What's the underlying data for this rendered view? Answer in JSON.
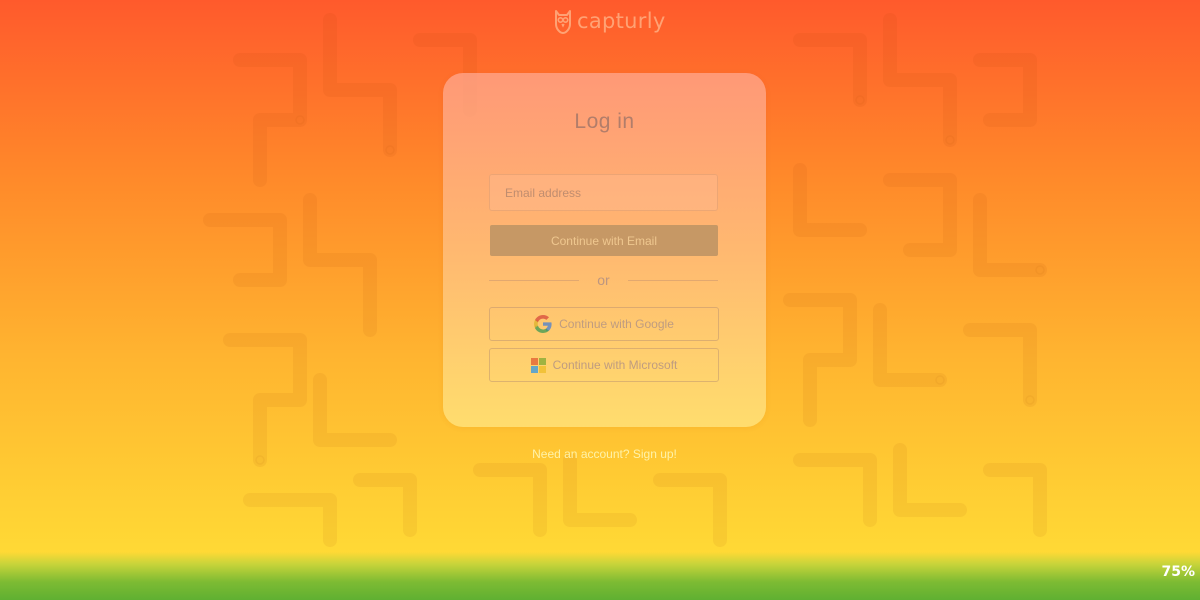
{
  "brand": {
    "name": "capturly",
    "logo_icon": "owl-icon"
  },
  "login_card": {
    "title": "Log in",
    "email_placeholder": "Email address",
    "email_value": "",
    "continue_email_label": "Continue with Email",
    "divider_text": "or",
    "google_label": "Continue with Google",
    "google_icon": "google-icon",
    "microsoft_label": "Continue with Microsoft",
    "microsoft_icon": "microsoft-icon"
  },
  "signup": {
    "text": "Need an account? Sign up!"
  },
  "overlay": {
    "zoom_percent": "75%"
  },
  "colors": {
    "gradient_top": "#ff5a2c",
    "gradient_middle": "#ffb530",
    "gradient_bottom": "#ffd935",
    "bottom_strip": "#5fb032",
    "email_button_bg": "#c69865"
  }
}
